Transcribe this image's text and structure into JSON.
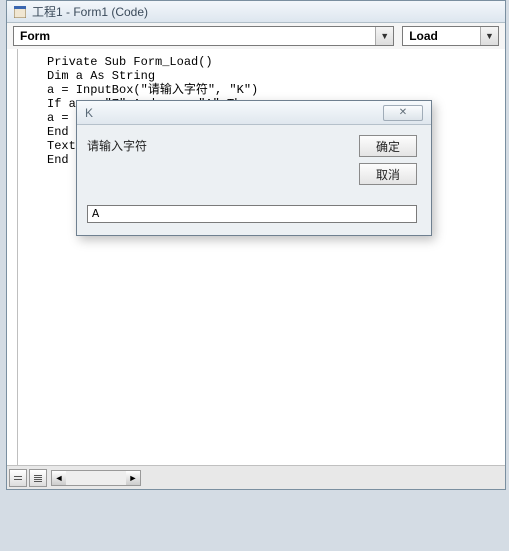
{
  "window": {
    "title": "工程1 - Form1 (Code)"
  },
  "selectors": {
    "object": "Form",
    "procedure": "Load"
  },
  "code": {
    "lines": [
      "Private Sub Form_Load()",
      "Dim a As String",
      "a = InputBox(\"请输入字符\", \"K\")",
      "If a <= \"Z\" And a >= \"A\" Then",
      "a = ",
      "End ",
      "Text",
      "End "
    ]
  },
  "inputbox": {
    "title": "K",
    "prompt": "请输入字符",
    "ok_label": "确定",
    "cancel_label": "取消",
    "close_glyph": "✕",
    "value": "A"
  },
  "glyphs": {
    "dropdown": "▼",
    "scroll_left": "◄",
    "scroll_right": "►"
  }
}
